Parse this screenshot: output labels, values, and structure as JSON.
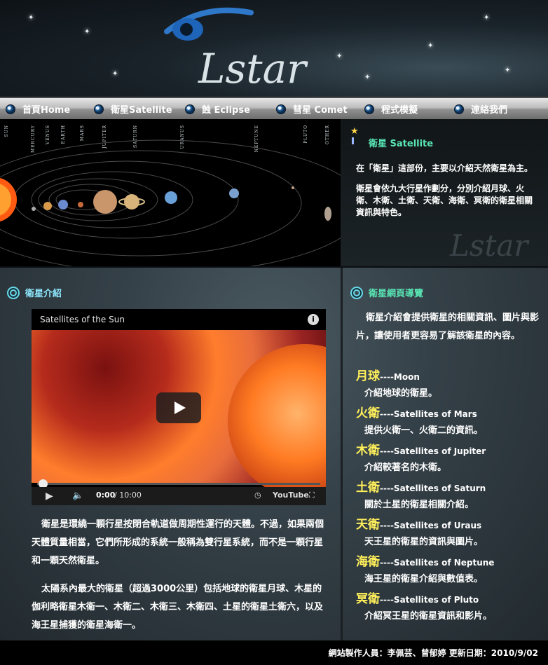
{
  "header": {
    "logo_text": "Lstar"
  },
  "nav": {
    "items": [
      {
        "label": "首頁Home"
      },
      {
        "label": "衛星Satellite"
      },
      {
        "label": "蝕 Eclipse"
      },
      {
        "label": "彗星 Comet"
      },
      {
        "label": "程式模擬"
      },
      {
        "label": "連絡我們"
      }
    ]
  },
  "banner": {
    "planet_labels": [
      "SUN",
      "MERCURY",
      "VENUS",
      "EARTH",
      "MARS",
      "JUPITER",
      "SATURN",
      "URANUS",
      "NEPTUNE",
      "PLUTO",
      "OTHER"
    ],
    "section_title": "衛星 Satellite",
    "intro_p1": "在「衛星」這部份，主要以介紹天然衛星為主。",
    "intro_p2": "衛星會依九大行星作劃分，分別介紹月球、火衛、木衛、土衛、天衛、海衛、冥衛的衛星相關資訊與特色。"
  },
  "left": {
    "title": "衛星介紹",
    "video": {
      "title": "Satellites of the Sun",
      "info": "i",
      "current_time": "0:00",
      "duration": "/ 10:00",
      "brand": "YouTube"
    },
    "para1": "衛星是環繞一顆行星按閉合軌道做周期性運行的天體。不過，如果兩個天體質量相當，它們所形成的系統一般稱為雙行星系統，而不是一顆行星和一顆天然衛星。",
    "para2": "太陽系內最大的衛星（超過3000公里）包括地球的衛星月球、木星的伽利略衛星木衛一、木衛二、木衛三、木衛四、土星的衛星土衛六，以及海王星捕獲的衛星海衛一。"
  },
  "right": {
    "title": "衛星網頁導覽",
    "intro": "衛星介紹會提供衛星的相關資訊、圖片與影片，讓使用者更容易了解該衛星的內容。",
    "items": [
      {
        "name": "月球",
        "english": "----Moon",
        "desc": "介紹地球的衛星。"
      },
      {
        "name": "火衛",
        "english": "----Satellites of Mars",
        "desc": "提供火衛一、火衛二的資訊。"
      },
      {
        "name": "木衛",
        "english": "----Satellites of Jupiter",
        "desc": "介紹較著名的木衛。"
      },
      {
        "name": "土衛",
        "english": "----Satellites of Saturn",
        "desc": "關於土星的衛星相關介紹。"
      },
      {
        "name": "天衛",
        "english": "----Satellites of Uraus",
        "desc": "天王星的衛星的資訊與圖片。"
      },
      {
        "name": "海衛",
        "english": "----Satellites of Neptune",
        "desc": "海王星的衛星介紹與數值表。"
      },
      {
        "name": "冥衛",
        "english": "----Satellites of Pluto",
        "desc": "介紹冥王星的衛星資訊和影片。"
      }
    ]
  },
  "footer": {
    "text": "網站製作人員：李佩芸、曾郁婷  更新日期：2010/9/02"
  },
  "colors": {
    "accent_cyan": "#7de8ff",
    "satellite_name_yellow": "#ffef5a",
    "section_green": "#59e6b5"
  }
}
